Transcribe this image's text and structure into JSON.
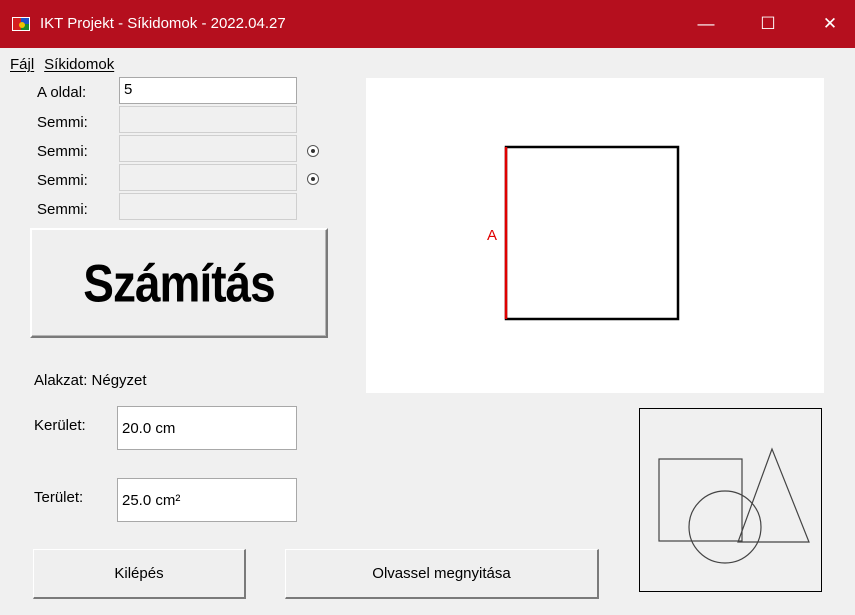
{
  "window": {
    "title": "IKT Projekt - Síkidomok - 2022.04.27",
    "controls": {
      "minimize": "—",
      "maximize": "☐",
      "close": "✕"
    },
    "accent_color": "#b50f1e"
  },
  "menu": [
    {
      "label": "Fájl"
    },
    {
      "label": "Síkidomok"
    }
  ],
  "inputs": [
    {
      "label": "A oldal:",
      "value": "5",
      "enabled": true
    },
    {
      "label": "Semmi:",
      "value": "",
      "enabled": false
    },
    {
      "label": "Semmi:",
      "value": "",
      "enabled": false
    },
    {
      "label": "Semmi:",
      "value": "",
      "enabled": false
    },
    {
      "label": "Semmi:",
      "value": "",
      "enabled": false
    }
  ],
  "calc_button": {
    "label": "Számítás"
  },
  "shape": {
    "label": "Alakzat: Négyzet"
  },
  "results": {
    "perimeter": {
      "label": "Kerület:",
      "value": "20.0 cm"
    },
    "area": {
      "label": "Terület:",
      "value": "25.0 cm²"
    }
  },
  "canvas": {
    "side_label": "A",
    "highlight_color": "#e00000"
  },
  "buttons": {
    "exit": "Kilépés",
    "open_readme": "Olvassel megnyitása"
  }
}
